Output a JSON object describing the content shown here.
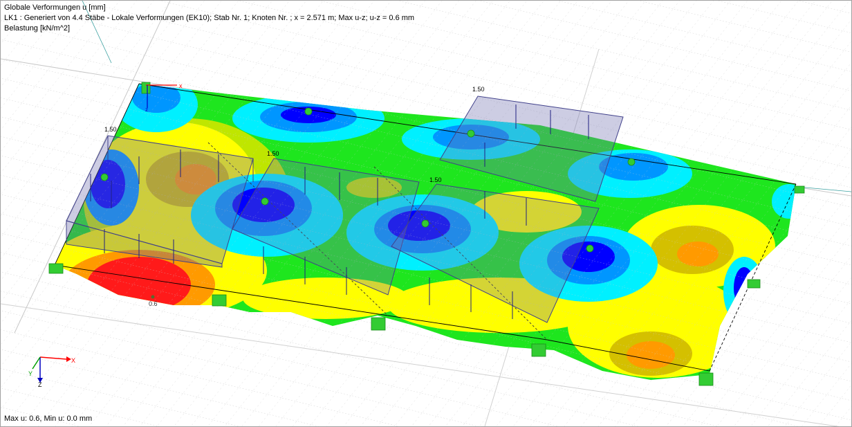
{
  "header": {
    "title": "Globale Verformungen u [mm]",
    "load_case": "LK1 : Generiert von  4.4 Stäbe - Lokale Verformungen (EK10); Stab Nr. 1; Knoten Nr. ; x = 2.571 m; Max u-z; u-z = 0.6 mm",
    "load_label": "Belastung [kN/m^2]"
  },
  "load_values": [
    "1.50",
    "1.50",
    "1.50",
    "1.50"
  ],
  "result_label": "0.6",
  "axes": {
    "x": "X",
    "y": "Y",
    "z": "Z"
  },
  "footer": {
    "status": "Max u: 0.6, Min u: 0.0 mm"
  },
  "colors": {
    "red": "#ff1a1a",
    "orange": "#ff9a00",
    "yellow": "#ffff00",
    "yellow_green": "#bfe600",
    "green": "#1ee61e",
    "teal": "#00d8a0",
    "cyan": "#00f0ff",
    "sky_blue": "#0096ff",
    "blue": "#0000ff",
    "load_box": "#5050a0",
    "support": "#33cc33"
  }
}
